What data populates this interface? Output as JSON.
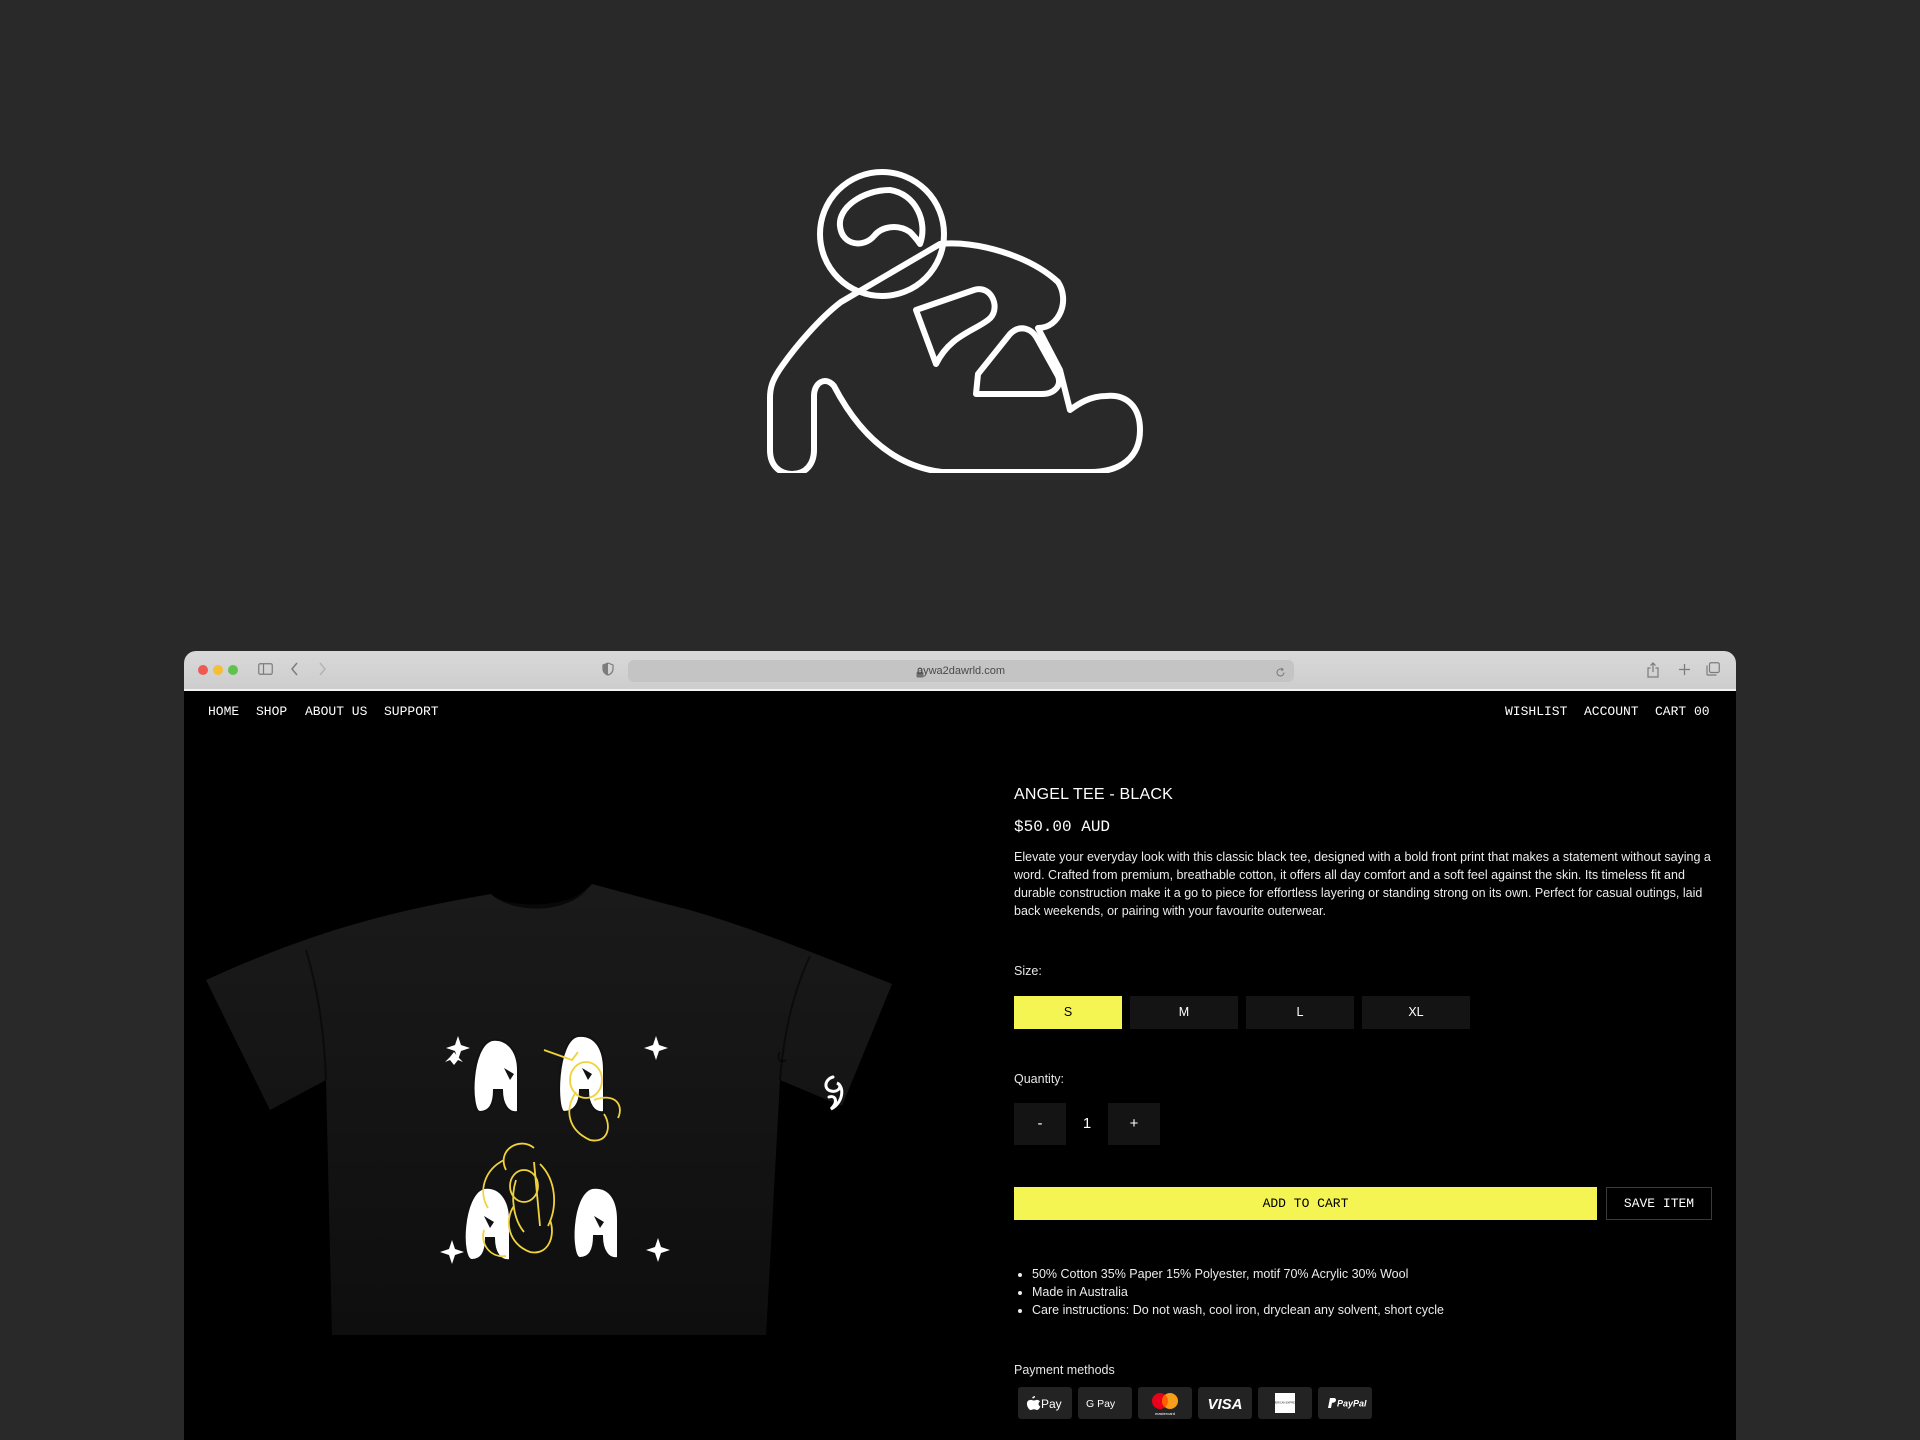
{
  "page": {
    "background": "#292929",
    "accent": "#f4f552"
  },
  "logo": {
    "icon": "reclining-figure-icon"
  },
  "browser": {
    "url": "aywa2dawrld.com"
  },
  "nav": {
    "left": [
      "HOME",
      "SHOP",
      "ABOUT US",
      "SUPPORT"
    ],
    "right": [
      "WISHLIST",
      "ACCOUNT",
      "CART 00"
    ]
  },
  "product": {
    "title": "ANGEL TEE - BLACK",
    "price": "$50.00 AUD",
    "description": "Elevate your everyday look with this classic black tee, designed with a bold front print that makes a statement without saying a word. Crafted from premium, breathable cotton, it offers all day comfort and a soft feel against the skin. Its timeless fit and durable construction make it a go to piece for effortless layering or standing strong on its own. Perfect for casual outings, laid back weekends, or pairing with your favourite outerwear.",
    "size_label": "Size:",
    "sizes": [
      "S",
      "M",
      "L",
      "XL"
    ],
    "selected_size": "S",
    "quantity_label": "Quantity:",
    "quantity": {
      "minus": "-",
      "value": "1",
      "plus": "+"
    },
    "add_to_cart": "ADD TO CART",
    "save_item": "SAVE ITEM",
    "details": [
      "50% Cotton 35% Paper 15% Polyester, motif 70% Acrylic 30% Wool",
      "Made in Australia",
      "Care instructions: Do not wash, cool iron, dryclean any solvent, short cycle"
    ],
    "payment_label": "Payment methods",
    "payment_methods": {
      "apple": "Pay",
      "google": "G Pay",
      "mastercard": "mastercard",
      "visa": "VISA",
      "amex": "AMERICAN EXPRESS",
      "paypal": "PayPal"
    }
  }
}
